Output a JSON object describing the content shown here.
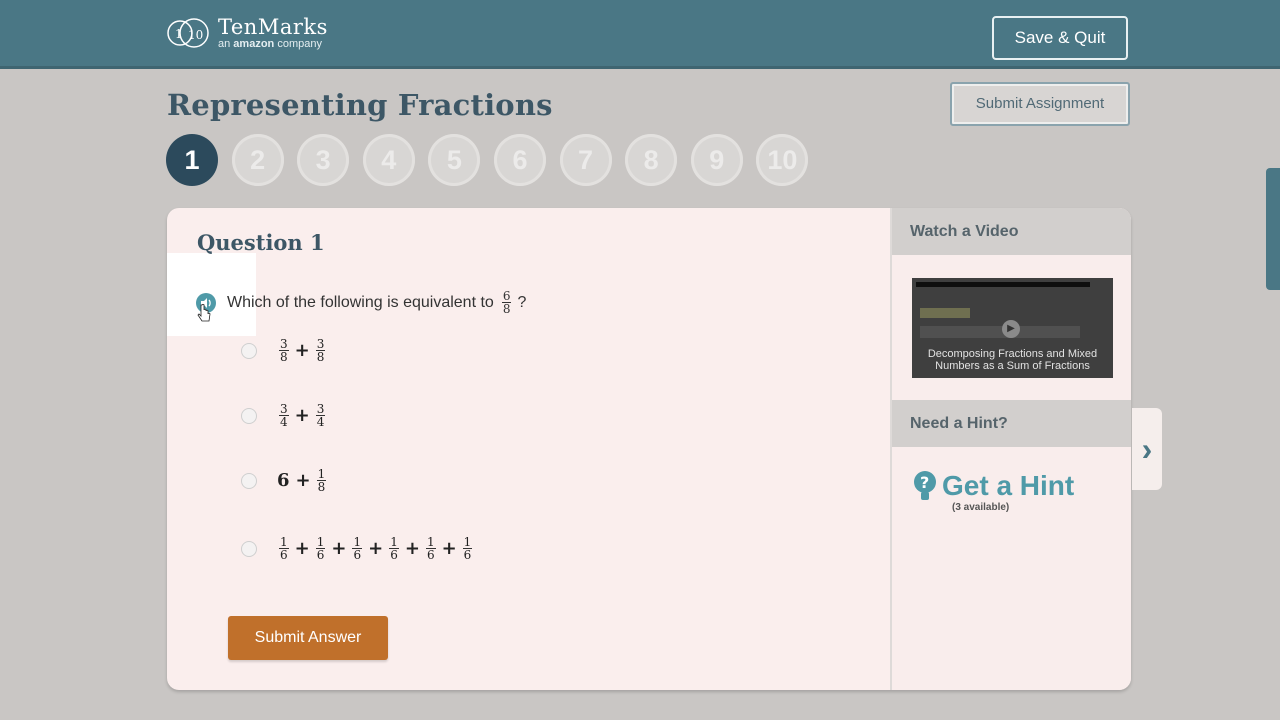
{
  "header": {
    "brand": "TenMarks",
    "tagline_pre": "an ",
    "tagline_brand": "amazon",
    "tagline_post": " company",
    "save_quit": "Save & Quit"
  },
  "assignment": {
    "title": "Representing Fractions",
    "submit_assignment": "Submit Assignment",
    "questions": [
      "1",
      "2",
      "3",
      "4",
      "5",
      "6",
      "7",
      "8",
      "9",
      "10"
    ],
    "active_question": "1"
  },
  "question": {
    "title": "Question 1",
    "prompt": "Which of the following is equivalent to",
    "prompt_fraction": {
      "num": "6",
      "den": "8"
    },
    "prompt_end": "?",
    "options": [
      {
        "terms": [
          {
            "num": "3",
            "den": "8"
          },
          {
            "num": "3",
            "den": "8"
          }
        ]
      },
      {
        "terms": [
          {
            "num": "3",
            "den": "4"
          },
          {
            "num": "3",
            "den": "4"
          }
        ]
      },
      {
        "whole": "6",
        "terms": [
          {
            "num": "1",
            "den": "8"
          }
        ]
      },
      {
        "terms": [
          {
            "num": "1",
            "den": "6"
          },
          {
            "num": "1",
            "den": "6"
          },
          {
            "num": "1",
            "den": "6"
          },
          {
            "num": "1",
            "den": "6"
          },
          {
            "num": "1",
            "den": "6"
          },
          {
            "num": "1",
            "den": "6"
          }
        ]
      }
    ],
    "plus": "+",
    "submit_answer": "Submit Answer"
  },
  "sidebar": {
    "video_heading": "Watch a Video",
    "video_caption": "Decomposing Fractions and Mixed Numbers as a Sum of Fractions",
    "hint_heading": "Need a Hint?",
    "hint_link": "Get a Hint",
    "hint_available": "(3 available)"
  },
  "colors": {
    "header_bg": "#4a7785",
    "accent_teal": "#4f9aa8",
    "submit_orange": "#c0702b",
    "title_navy": "#3d5766",
    "active_circle": "#2c4a5c"
  }
}
